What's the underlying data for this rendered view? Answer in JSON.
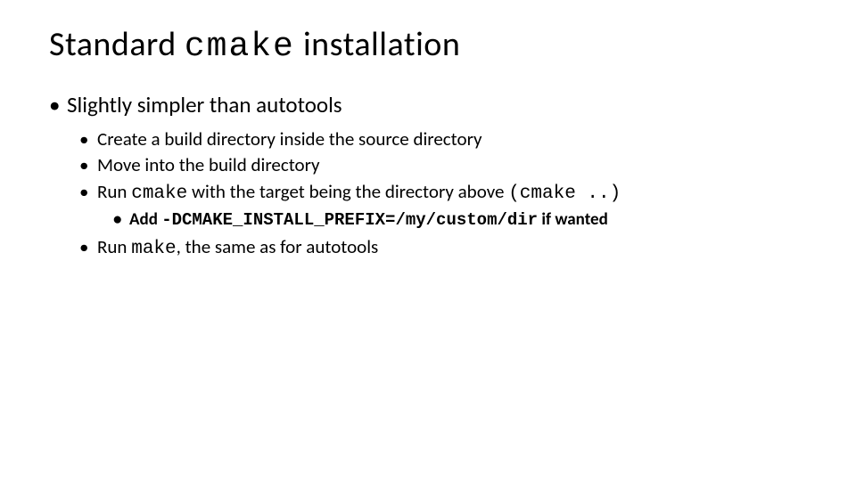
{
  "title": {
    "pre": "Standard ",
    "code": "cmake",
    "post": " installation"
  },
  "lvl1_item": "Slightly simpler than autotools",
  "lvl2": {
    "a": "Create a build directory inside the source directory",
    "b": "Move into the build directory",
    "c": {
      "pre": "Run ",
      "code1": "cmake",
      "mid": " with the target being the directory above ",
      "code2": "(cmake ..)"
    },
    "d": {
      "pre": "Run ",
      "code": "make",
      "post": ", the same as for autotools"
    }
  },
  "lvl3": {
    "pre": "Add ",
    "code": "-DCMAKE_INSTALL_PREFIX=/my/custom/dir",
    "post": " if wanted"
  }
}
